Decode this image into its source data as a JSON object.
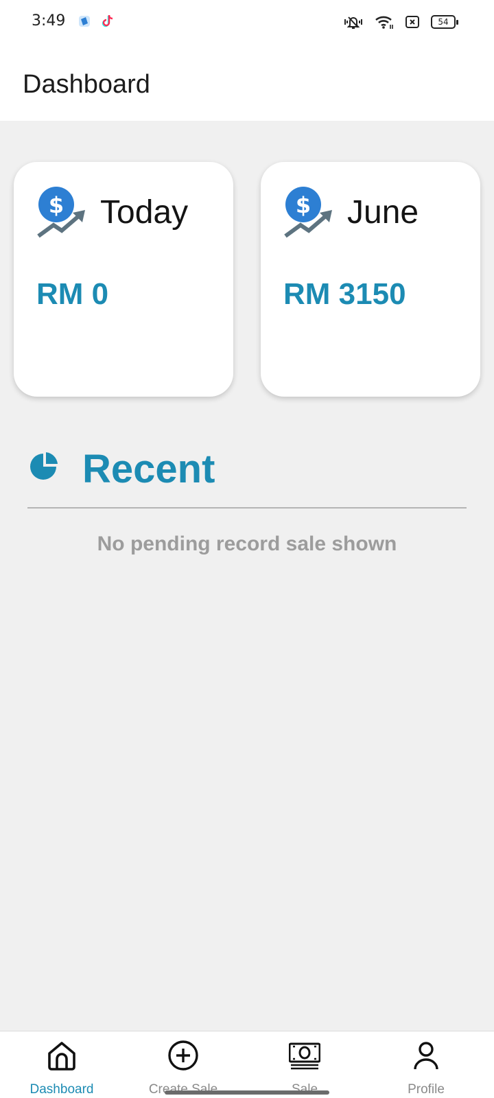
{
  "status_bar": {
    "time": "3:49",
    "battery": "54",
    "icons": [
      "app-icon-blue",
      "tiktok-icon",
      "vibrate-icon",
      "wifi-icon",
      "sim-off-icon",
      "battery-icon"
    ]
  },
  "header": {
    "title": "Dashboard"
  },
  "summary": {
    "today": {
      "label": "Today",
      "amount": "RM 0",
      "icon": "dollar-trend-icon"
    },
    "month": {
      "label": "June",
      "amount": "RM 3150",
      "icon": "dollar-trend-icon"
    }
  },
  "recent": {
    "title": "Recent",
    "icon": "pie-chart-icon",
    "empty_message": "No pending record sale shown"
  },
  "bottom_nav": {
    "items": [
      {
        "label": "Dashboard",
        "icon": "home-icon",
        "active": true
      },
      {
        "label": "Create Sale",
        "icon": "plus-circle-icon",
        "active": false
      },
      {
        "label": "Sale",
        "icon": "cash-icon",
        "active": false
      },
      {
        "label": "Profile",
        "icon": "user-icon",
        "active": false
      }
    ]
  },
  "colors": {
    "accent": "#1c8bb3",
    "background": "#f0f0f0",
    "card": "#ffffff",
    "muted_text": "#9c9c9c",
    "icon_blue": "#2d7fd3",
    "icon_gray": "#5d7380"
  }
}
